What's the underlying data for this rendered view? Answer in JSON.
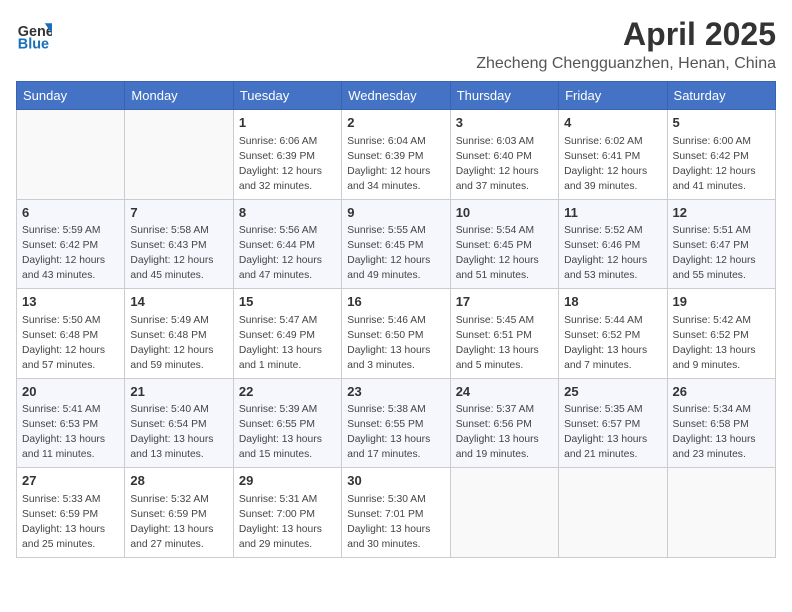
{
  "header": {
    "logo_line1": "General",
    "logo_line2": "Blue",
    "month": "April 2025",
    "location": "Zhecheng Chengguanzhen, Henan, China"
  },
  "weekdays": [
    "Sunday",
    "Monday",
    "Tuesday",
    "Wednesday",
    "Thursday",
    "Friday",
    "Saturday"
  ],
  "weeks": [
    [
      {
        "day": "",
        "info": ""
      },
      {
        "day": "",
        "info": ""
      },
      {
        "day": "1",
        "sunrise": "Sunrise: 6:06 AM",
        "sunset": "Sunset: 6:39 PM",
        "daylight": "Daylight: 12 hours and 32 minutes."
      },
      {
        "day": "2",
        "sunrise": "Sunrise: 6:04 AM",
        "sunset": "Sunset: 6:39 PM",
        "daylight": "Daylight: 12 hours and 34 minutes."
      },
      {
        "day": "3",
        "sunrise": "Sunrise: 6:03 AM",
        "sunset": "Sunset: 6:40 PM",
        "daylight": "Daylight: 12 hours and 37 minutes."
      },
      {
        "day": "4",
        "sunrise": "Sunrise: 6:02 AM",
        "sunset": "Sunset: 6:41 PM",
        "daylight": "Daylight: 12 hours and 39 minutes."
      },
      {
        "day": "5",
        "sunrise": "Sunrise: 6:00 AM",
        "sunset": "Sunset: 6:42 PM",
        "daylight": "Daylight: 12 hours and 41 minutes."
      }
    ],
    [
      {
        "day": "6",
        "sunrise": "Sunrise: 5:59 AM",
        "sunset": "Sunset: 6:42 PM",
        "daylight": "Daylight: 12 hours and 43 minutes."
      },
      {
        "day": "7",
        "sunrise": "Sunrise: 5:58 AM",
        "sunset": "Sunset: 6:43 PM",
        "daylight": "Daylight: 12 hours and 45 minutes."
      },
      {
        "day": "8",
        "sunrise": "Sunrise: 5:56 AM",
        "sunset": "Sunset: 6:44 PM",
        "daylight": "Daylight: 12 hours and 47 minutes."
      },
      {
        "day": "9",
        "sunrise": "Sunrise: 5:55 AM",
        "sunset": "Sunset: 6:45 PM",
        "daylight": "Daylight: 12 hours and 49 minutes."
      },
      {
        "day": "10",
        "sunrise": "Sunrise: 5:54 AM",
        "sunset": "Sunset: 6:45 PM",
        "daylight": "Daylight: 12 hours and 51 minutes."
      },
      {
        "day": "11",
        "sunrise": "Sunrise: 5:52 AM",
        "sunset": "Sunset: 6:46 PM",
        "daylight": "Daylight: 12 hours and 53 minutes."
      },
      {
        "day": "12",
        "sunrise": "Sunrise: 5:51 AM",
        "sunset": "Sunset: 6:47 PM",
        "daylight": "Daylight: 12 hours and 55 minutes."
      }
    ],
    [
      {
        "day": "13",
        "sunrise": "Sunrise: 5:50 AM",
        "sunset": "Sunset: 6:48 PM",
        "daylight": "Daylight: 12 hours and 57 minutes."
      },
      {
        "day": "14",
        "sunrise": "Sunrise: 5:49 AM",
        "sunset": "Sunset: 6:48 PM",
        "daylight": "Daylight: 12 hours and 59 minutes."
      },
      {
        "day": "15",
        "sunrise": "Sunrise: 5:47 AM",
        "sunset": "Sunset: 6:49 PM",
        "daylight": "Daylight: 13 hours and 1 minute."
      },
      {
        "day": "16",
        "sunrise": "Sunrise: 5:46 AM",
        "sunset": "Sunset: 6:50 PM",
        "daylight": "Daylight: 13 hours and 3 minutes."
      },
      {
        "day": "17",
        "sunrise": "Sunrise: 5:45 AM",
        "sunset": "Sunset: 6:51 PM",
        "daylight": "Daylight: 13 hours and 5 minutes."
      },
      {
        "day": "18",
        "sunrise": "Sunrise: 5:44 AM",
        "sunset": "Sunset: 6:52 PM",
        "daylight": "Daylight: 13 hours and 7 minutes."
      },
      {
        "day": "19",
        "sunrise": "Sunrise: 5:42 AM",
        "sunset": "Sunset: 6:52 PM",
        "daylight": "Daylight: 13 hours and 9 minutes."
      }
    ],
    [
      {
        "day": "20",
        "sunrise": "Sunrise: 5:41 AM",
        "sunset": "Sunset: 6:53 PM",
        "daylight": "Daylight: 13 hours and 11 minutes."
      },
      {
        "day": "21",
        "sunrise": "Sunrise: 5:40 AM",
        "sunset": "Sunset: 6:54 PM",
        "daylight": "Daylight: 13 hours and 13 minutes."
      },
      {
        "day": "22",
        "sunrise": "Sunrise: 5:39 AM",
        "sunset": "Sunset: 6:55 PM",
        "daylight": "Daylight: 13 hours and 15 minutes."
      },
      {
        "day": "23",
        "sunrise": "Sunrise: 5:38 AM",
        "sunset": "Sunset: 6:55 PM",
        "daylight": "Daylight: 13 hours and 17 minutes."
      },
      {
        "day": "24",
        "sunrise": "Sunrise: 5:37 AM",
        "sunset": "Sunset: 6:56 PM",
        "daylight": "Daylight: 13 hours and 19 minutes."
      },
      {
        "day": "25",
        "sunrise": "Sunrise: 5:35 AM",
        "sunset": "Sunset: 6:57 PM",
        "daylight": "Daylight: 13 hours and 21 minutes."
      },
      {
        "day": "26",
        "sunrise": "Sunrise: 5:34 AM",
        "sunset": "Sunset: 6:58 PM",
        "daylight": "Daylight: 13 hours and 23 minutes."
      }
    ],
    [
      {
        "day": "27",
        "sunrise": "Sunrise: 5:33 AM",
        "sunset": "Sunset: 6:59 PM",
        "daylight": "Daylight: 13 hours and 25 minutes."
      },
      {
        "day": "28",
        "sunrise": "Sunrise: 5:32 AM",
        "sunset": "Sunset: 6:59 PM",
        "daylight": "Daylight: 13 hours and 27 minutes."
      },
      {
        "day": "29",
        "sunrise": "Sunrise: 5:31 AM",
        "sunset": "Sunset: 7:00 PM",
        "daylight": "Daylight: 13 hours and 29 minutes."
      },
      {
        "day": "30",
        "sunrise": "Sunrise: 5:30 AM",
        "sunset": "Sunset: 7:01 PM",
        "daylight": "Daylight: 13 hours and 30 minutes."
      },
      {
        "day": "",
        "info": ""
      },
      {
        "day": "",
        "info": ""
      },
      {
        "day": "",
        "info": ""
      }
    ]
  ]
}
